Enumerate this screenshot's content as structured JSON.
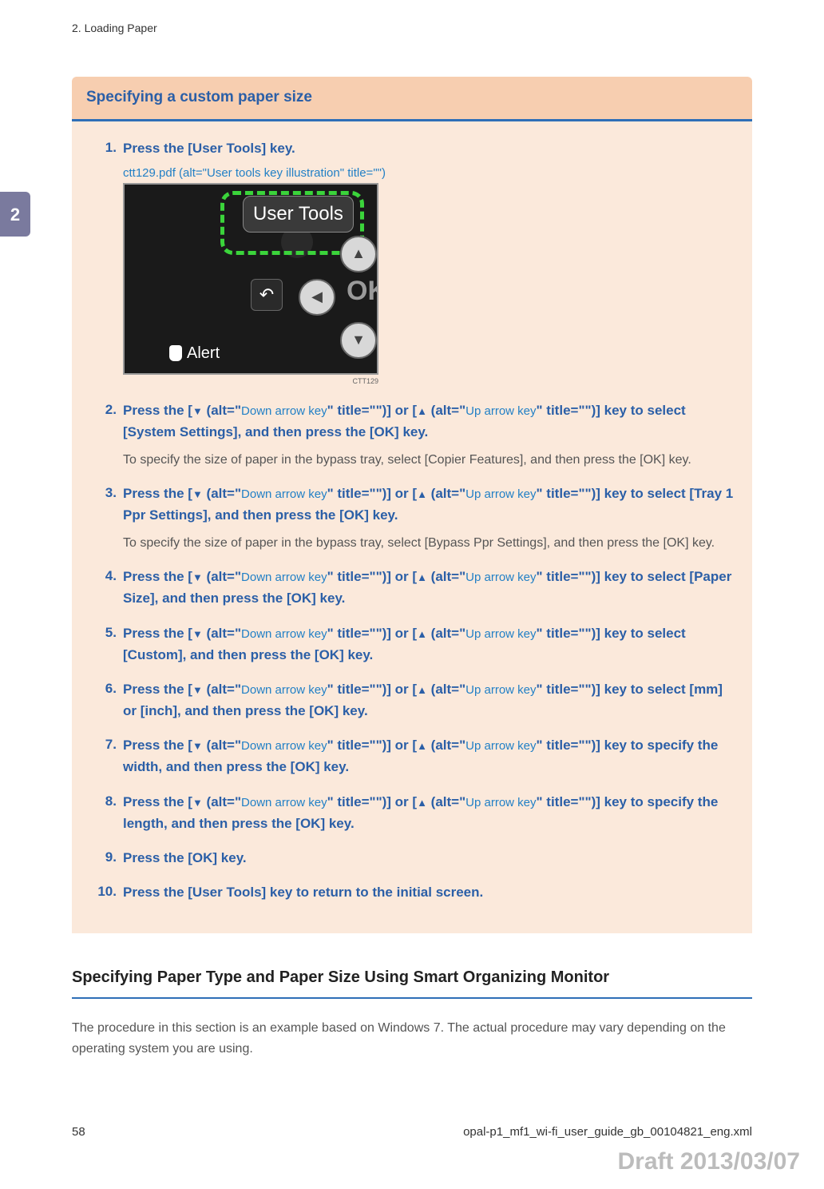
{
  "header": {
    "chapter": "2. Loading Paper"
  },
  "sidebar_tab": "2",
  "section1": {
    "title": "Specifying a custom paper size",
    "image_ref": "ctt129.pdf",
    "image_alt_prefix": " (alt=\"",
    "image_alt": "User tools key illustration",
    "image_alt_suffix": "\" title=\"\")",
    "panel_label": "User Tools",
    "panel_alert": "Alert",
    "panel_ok": "OK",
    "image_code": "CTT129",
    "down_alt": "Down arrow key",
    "up_alt": "Up arrow key",
    "alt_prefix": " (alt=\"",
    "alt_mid": "\" title=\"\")] or [",
    "alt_suffix": "\" title=\"\")] key to",
    "steps": [
      {
        "main_simple": "Press the [User Tools] key."
      },
      {
        "prefix": "Press the [",
        "tail": "select [System Settings], and then press the [OK] key.",
        "note": "To specify the size of paper in the bypass tray, select [Copier Features], and then press the [OK] key."
      },
      {
        "prefix": "Press the [",
        "tail": "select [Tray 1 Ppr Settings], and then press the [OK] key.",
        "note": "To specify the size of paper in the bypass tray, select [Bypass Ppr Settings], and then press the [OK] key."
      },
      {
        "prefix": "Press the [",
        "tail": "select [Paper Size], and then press the [OK] key."
      },
      {
        "prefix": "Press the [",
        "tail": "select [Custom], and then press the [OK] key."
      },
      {
        "prefix": "Press the [",
        "tail": "select [mm] or [inch], and then press the [OK] key."
      },
      {
        "prefix": "Press the [",
        "tail": "specify the width, and then press the [OK] key."
      },
      {
        "prefix": "Press the [",
        "tail": "specify the length, and then press the [OK] key."
      },
      {
        "main_simple": "Press the [OK] key."
      },
      {
        "main_simple": "Press the [User Tools] key to return to the initial screen."
      }
    ]
  },
  "section2": {
    "title": "Specifying Paper Type and Paper Size Using Smart Organizing Monitor",
    "text": "The procedure in this section is an example based on Windows 7. The actual procedure may vary depending on the operating system you are using."
  },
  "footer": {
    "page_no": "58",
    "doc_id": "opal-p1_mf1_wi-fi_user_guide_gb_00104821_eng.xml"
  },
  "draft": "Draft 2013/03/07"
}
